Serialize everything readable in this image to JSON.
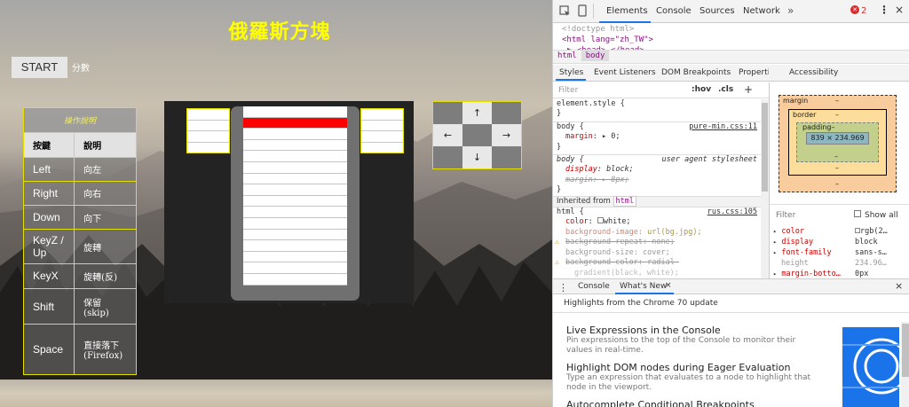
{
  "game": {
    "title": "俄羅斯方塊",
    "start_label": "START",
    "score_label": "分數",
    "controls": {
      "caption": "操作說明",
      "headers": [
        "按鍵",
        "說明"
      ],
      "rows": [
        {
          "key": "Left",
          "desc": "向左"
        },
        {
          "key": "Right",
          "desc": "向右"
        },
        {
          "key": "Down",
          "desc": "向下"
        },
        {
          "key": "KeyZ / Up",
          "desc": "旋轉"
        },
        {
          "key": "KeyX",
          "desc": "旋轉(反)"
        },
        {
          "key": "Shift",
          "desc": "保留 (skip)"
        },
        {
          "key": "Space",
          "desc": "直接落下 (Firefox)"
        }
      ]
    },
    "dpad": {
      "up": "↑",
      "left": "←",
      "right": "→",
      "down": "↓"
    }
  },
  "devtools": {
    "tabs": [
      "Elements",
      "Console",
      "Sources",
      "Network"
    ],
    "more_tabs": "»",
    "error_count": "2",
    "dom_lines": [
      "<!doctype html>",
      "<html lang=\"zh_TW\">",
      "▶ <head>…</head>"
    ],
    "breadcrumbs": [
      "html",
      "body"
    ],
    "subtabs": [
      "Styles",
      "Event Listeners",
      "DOM Breakpoints",
      "Properties",
      "Accessibility"
    ],
    "filter_placeholder": "Filter",
    "hov": ":hov",
    "cls": ".cls",
    "plus": "+",
    "styles": {
      "element_style": "element.style {",
      "close": "}",
      "body1_selector": "body {",
      "body1_source": "pure-min.css:11",
      "body1_prop": "margin",
      "body1_value": "▸ 0;",
      "body2_selector": "body {",
      "body2_source": "user agent stylesheet",
      "body2_prop1": "display",
      "body2_val1": "block;",
      "body2_prop2": "margin",
      "body2_val2": "▸ 8px;",
      "inherited_label": "Inherited from",
      "inherited_from": "html",
      "html_selector": "html {",
      "html_source": "rus.css:105",
      "html_color_prop": "color",
      "html_color_val": "white;",
      "html_bgimg_prop": "background-image",
      "html_bgimg_val": "url(bg.jpg);",
      "html_bgrep": "background-repeat: none;",
      "html_bgsize": "background-size: cover;",
      "html_bgcolor": "background-color: radial-",
      "html_bgcolor2": "gradient(black, white);"
    },
    "box_model": {
      "margin_label": "margin",
      "border_label": "border",
      "padding_label": "padding–",
      "content_size": "839 × 234.969",
      "dash": "–"
    },
    "computed": {
      "filter": "Filter",
      "show_all": "Show all",
      "rows": [
        {
          "prop": "color",
          "val": "rgb(2…"
        },
        {
          "prop": "display",
          "val": "block"
        },
        {
          "prop": "font-family",
          "val": "sans-s…"
        },
        {
          "prop": "height",
          "val": "234.96…"
        },
        {
          "prop": "margin-botto…",
          "val": "0px"
        }
      ]
    },
    "drawer_tabs": [
      "Console",
      "What's New"
    ],
    "drawer_close": "×",
    "whats_new": {
      "heading": "Highlights from the Chrome 70 update",
      "items": [
        {
          "title": "Live Expressions in the Console",
          "desc": "Pin expressions to the top of the Console to monitor their values in real-time."
        },
        {
          "title": "Highlight DOM nodes during Eager Evaluation",
          "desc": "Type an expression that evaluates to a node to highlight that node in the viewport."
        },
        {
          "title": "Autocomplete Conditional Breakpoints",
          "desc": ""
        }
      ]
    }
  },
  "colors": {
    "accent": "#1a73e8",
    "title_yellow": "#ffff00",
    "table_border": "#e3e000",
    "piece": "#ff0000"
  }
}
